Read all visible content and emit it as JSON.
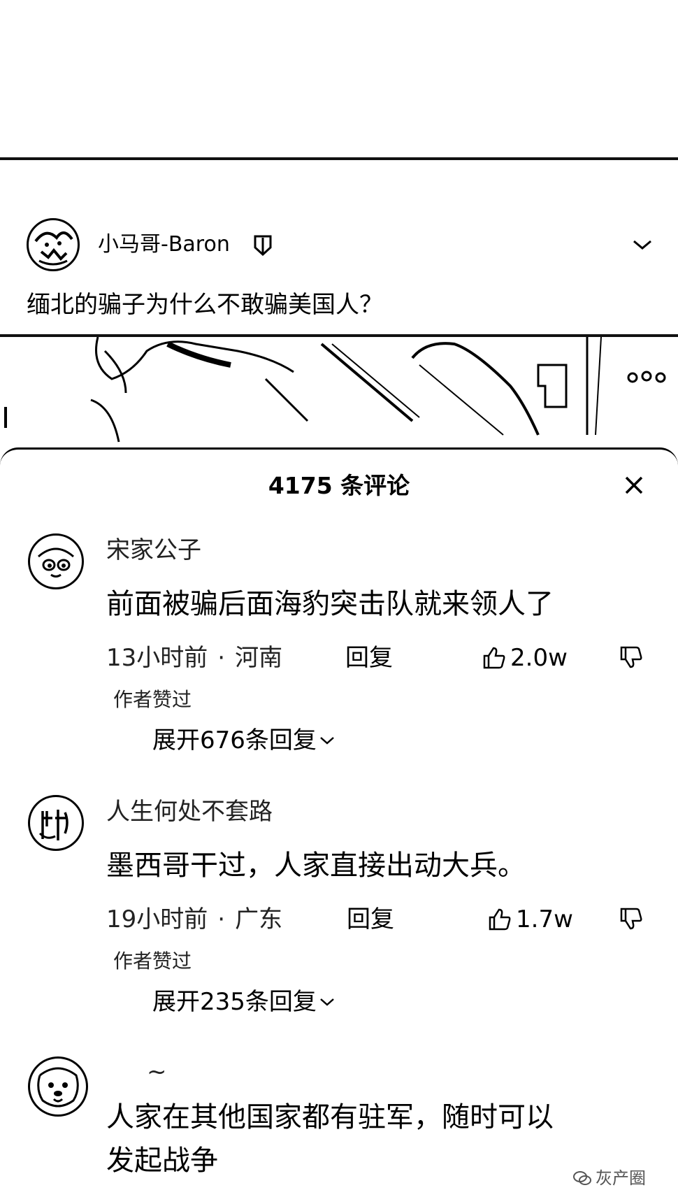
{
  "post": {
    "author": "小马哥-Baron",
    "title": "缅北的骗子为什么不敢骗美国人？"
  },
  "comments_sheet": {
    "title": "4175 条评论",
    "comments": [
      {
        "user": "宋家公子",
        "text": "前面被骗后面海豹突击队就来领人了",
        "time": "13小时前",
        "location": "河南",
        "reply_label": "回复",
        "likes": "2.0w",
        "author_liked": "作者赞过",
        "expand_label": "展开676条回复"
      },
      {
        "user": "人生何处不套路",
        "text": "墨西哥干过，人家直接出动大兵。",
        "time": "19小时前",
        "location": "广东",
        "reply_label": "回复",
        "likes": "1.7w",
        "author_liked": "作者赞过",
        "expand_label": "展开235条回复"
      },
      {
        "user": "~",
        "text_line1": "人家在其他国家都有驻军，随时可以",
        "text_line2": "发起战争"
      }
    ]
  },
  "watermark": "灰产圈",
  "icons": {
    "verified": "verified-badge-icon",
    "chevron": "chevron-down-icon",
    "close": "close-icon",
    "like": "thumbs-up-icon",
    "dislike": "thumbs-down-icon"
  }
}
